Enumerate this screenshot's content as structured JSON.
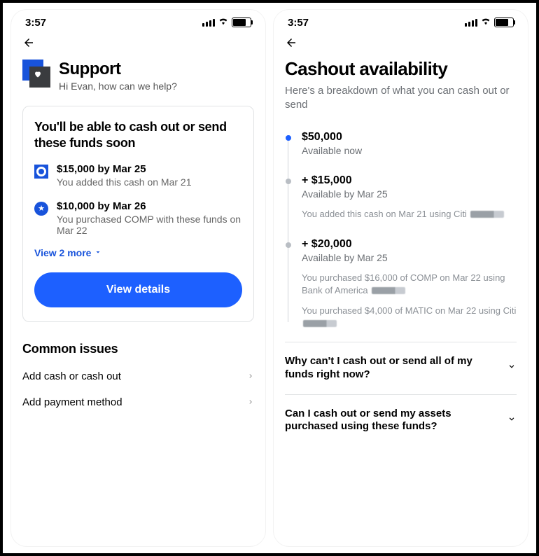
{
  "status": {
    "time": "3:57"
  },
  "left": {
    "support": {
      "title": "Support",
      "subtitle": "Hi Evan, how can we help?"
    },
    "card": {
      "title": "You'll be able to cash out or send these funds soon",
      "row1": {
        "amount": "$15,000 by Mar 25",
        "desc": "You added this cash on Mar 21"
      },
      "row2": {
        "amount": "$10,000 by Mar 26",
        "desc": "You purchased COMP with these funds on Mar 22"
      },
      "view_more": "View 2 more",
      "button": "View details"
    },
    "common_issues": {
      "title": "Common issues",
      "item1": "Add cash or cash out",
      "item2": "Add payment method"
    }
  },
  "right": {
    "title": "Cashout availability",
    "subtitle": "Here's a breakdown of what you can cash out or send",
    "t1": {
      "amount": "$50,000",
      "avail": "Available now"
    },
    "t2": {
      "amount": "+ $15,000",
      "avail": "Available by Mar 25",
      "note": "You added this cash on Mar 21 using Citi "
    },
    "t3": {
      "amount": "+ $20,000",
      "avail": "Available by Mar 25",
      "note1": "You purchased $16,000 of COMP on Mar 22  using Bank of America ",
      "note2": "You purchased $4,000 of MATIC on Mar 22 using Citi "
    },
    "faq1": "Why can't I cash out or send all of my funds right now?",
    "faq2": "Can I cash out or send my assets purchased using these funds?"
  }
}
